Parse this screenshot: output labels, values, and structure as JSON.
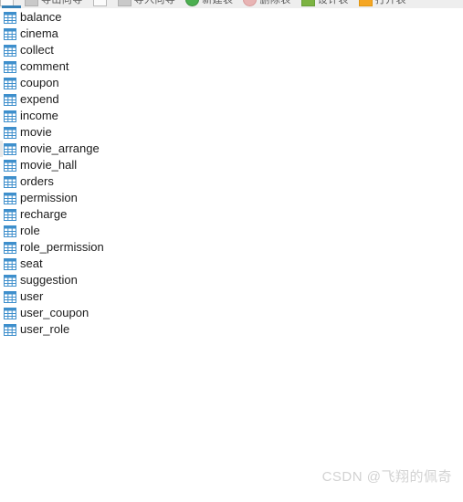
{
  "window": {
    "background_color": "#ffffff",
    "panel_type": "database-table-list"
  },
  "toolbar": {
    "background_color": "#eeeeee",
    "active_indicator_color": "#3580b5",
    "groups": [
      {
        "icon": "checkbox-icon",
        "label": ""
      },
      {
        "icon": "square-gray-icon",
        "label": "导出向导"
      },
      {
        "icon": "document-icon",
        "label": ""
      },
      {
        "icon": "square-gray-icon",
        "label": "导入向导"
      },
      {
        "icon": "circle-green-icon",
        "label": "新建表"
      },
      {
        "icon": "circle-pink-icon",
        "label": "删除表"
      },
      {
        "icon": "leaf-green-icon",
        "label": "设计表"
      },
      {
        "icon": "square-orange-icon",
        "label": "打开表"
      }
    ]
  },
  "table_list": {
    "icon_name": "table-grid-icon",
    "icon_color": "#3e8fcc",
    "hovered_index": 8,
    "items": [
      {
        "name": "balance"
      },
      {
        "name": "cinema"
      },
      {
        "name": "collect"
      },
      {
        "name": "comment"
      },
      {
        "name": "coupon"
      },
      {
        "name": "expend"
      },
      {
        "name": "income"
      },
      {
        "name": "movie"
      },
      {
        "name": "movie_arrange"
      },
      {
        "name": "movie_hall"
      },
      {
        "name": "orders"
      },
      {
        "name": "permission"
      },
      {
        "name": "recharge"
      },
      {
        "name": "role"
      },
      {
        "name": "role_permission"
      },
      {
        "name": "seat"
      },
      {
        "name": "suggestion"
      },
      {
        "name": "user"
      },
      {
        "name": "user_coupon"
      },
      {
        "name": "user_role"
      }
    ]
  },
  "watermark": {
    "text": "CSDN @飞翔的佩奇",
    "color": "#d2d2d2"
  }
}
